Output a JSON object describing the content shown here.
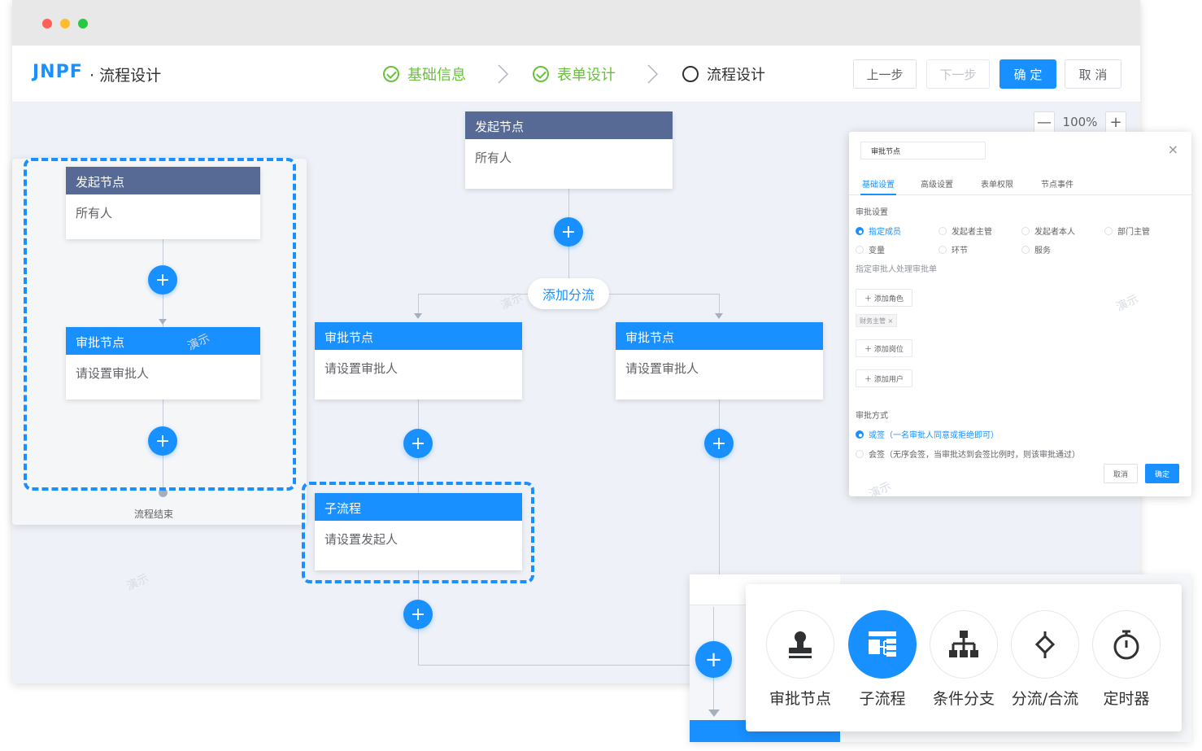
{
  "window": {
    "logo": "JNPF",
    "app_title": "· 流程设计",
    "steps": [
      {
        "label": "基础信息",
        "state": "done"
      },
      {
        "label": "表单设计",
        "state": "done"
      },
      {
        "label": "流程设计",
        "state": "current"
      }
    ],
    "buttons": {
      "prev": "上一步",
      "next": "下一步",
      "confirm": "确 定",
      "cancel": "取 消"
    }
  },
  "zoom": {
    "minus": "—",
    "value": "100%",
    "plus": "+"
  },
  "left_card": {
    "start": {
      "title": "发起节点",
      "body": "所有人"
    },
    "approve": {
      "title": "审批节点",
      "body": "请设置审批人"
    },
    "end_label": "流程结束"
  },
  "main_flow": {
    "start": {
      "title": "发起节点",
      "body": "所有人"
    },
    "branch_label": "添加分流",
    "branch_left": {
      "title": "审批节点",
      "body": "请设置审批人"
    },
    "branch_right": {
      "title": "审批节点",
      "body": "请设置审批人"
    },
    "subprocess": {
      "title": "子流程",
      "body": "请设置发起人"
    }
  },
  "watermark": "演示",
  "panel": {
    "title": "审批节点",
    "close": "×",
    "tabs": [
      "基础设置",
      "高级设置",
      "表单权限",
      "节点事件"
    ],
    "section_approval": "审批设置",
    "options_row1": [
      "指定成员",
      "发起者主管",
      "发起者本人",
      "部门主管"
    ],
    "options_row2": [
      "变量",
      "环节",
      "服务"
    ],
    "hint": "指定审批人处理审批单",
    "btn_add_role": "＋ 添加角色",
    "tag": "财务主管 ×",
    "btn_add_post": "＋ 添加岗位",
    "btn_add_user": "＋ 添加用户",
    "section_method": "审批方式",
    "method_or": "或签（一名审批人同意或拒绝即可）",
    "method_and": "会签（无序会签，当审批达到会签比例时，则该审批通过）",
    "cancel": "取消",
    "confirm": "确定"
  },
  "popup": {
    "items": [
      {
        "label": "审批节点",
        "icon": "stamp-icon"
      },
      {
        "label": "子流程",
        "icon": "subprocess-icon"
      },
      {
        "label": "条件分支",
        "icon": "branch-icon"
      },
      {
        "label": "分流/合流",
        "icon": "diamond-icon"
      },
      {
        "label": "定时器",
        "icon": "timer-icon"
      }
    ]
  },
  "colors": {
    "primary": "#1890ff",
    "start_head": "#576a95",
    "done": "#67c23a"
  }
}
